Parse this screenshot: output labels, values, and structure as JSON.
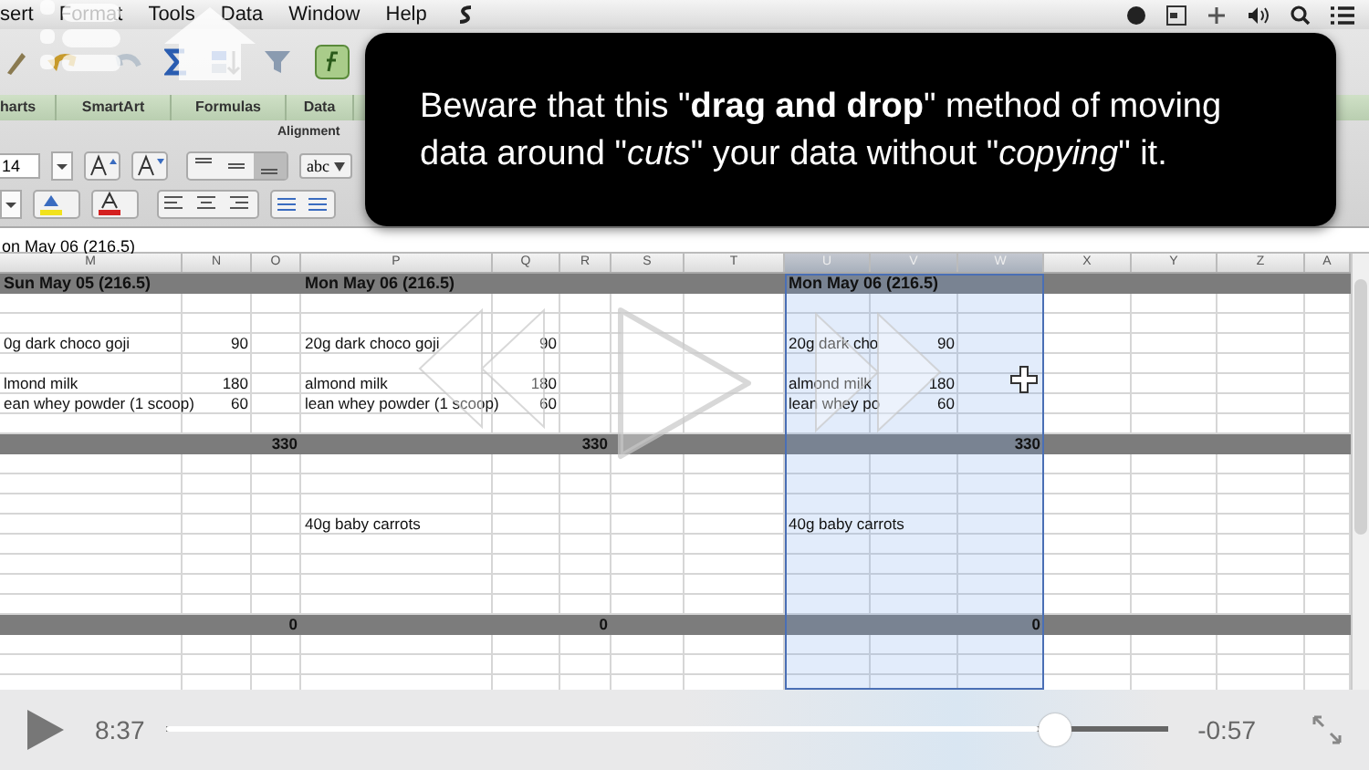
{
  "menu_bar": {
    "items": [
      "sert",
      "Format",
      "Tools",
      "Data",
      "Window",
      "Help"
    ]
  },
  "ribbon": {
    "tabs": [
      {
        "label": "harts",
        "selected": false
      },
      {
        "label": "SmartArt",
        "selected": false
      },
      {
        "label": "Formulas",
        "selected": false
      },
      {
        "label": "Data",
        "selected": false
      }
    ],
    "group_label": "Alignment",
    "font_size": "14",
    "wrap_button": "abc"
  },
  "callout": {
    "text": "Beware that this \"**drag and drop**\" method of moving data around \"*cuts*\" your data without \"*copying*\" it."
  },
  "formula_bar": {
    "value": "on May 06 (216.5)"
  },
  "sheet": {
    "columns": [
      {
        "label": "M",
        "selected": false
      },
      {
        "label": "N",
        "selected": false
      },
      {
        "label": "O",
        "selected": false
      },
      {
        "label": "P",
        "selected": false
      },
      {
        "label": "Q",
        "selected": false
      },
      {
        "label": "R",
        "selected": false
      },
      {
        "label": "S",
        "selected": false
      },
      {
        "label": "T",
        "selected": false
      },
      {
        "label": "U",
        "selected": true
      },
      {
        "label": "V",
        "selected": true
      },
      {
        "label": "W",
        "selected": true
      },
      {
        "label": "X",
        "selected": false
      },
      {
        "label": "Y",
        "selected": false
      },
      {
        "label": "Z",
        "selected": false
      },
      {
        "label": "A",
        "selected": false
      }
    ],
    "rows": [
      {
        "kind": "band",
        "cells": [
          {
            "kind": "title",
            "text": "Sun May 05 (216.5)"
          },
          null,
          null,
          {
            "kind": "title",
            "text": "Mon May 06 (216.5)"
          },
          null,
          null,
          null,
          null,
          {
            "kind": "title",
            "text": "Mon May 06 (216.5)"
          },
          null,
          null,
          null,
          null,
          null,
          null
        ]
      },
      {
        "kind": "blank"
      },
      {
        "kind": "blank"
      },
      {
        "kind": "data",
        "cells": [
          {
            "kind": "label",
            "text": "0g dark choco goji"
          },
          {
            "kind": "number",
            "text": "90"
          },
          null,
          {
            "kind": "label",
            "text": "20g dark choco goji"
          },
          {
            "kind": "number",
            "text": "90"
          },
          null,
          null,
          null,
          {
            "kind": "label",
            "text": "20g dark cho"
          },
          {
            "kind": "number",
            "text": "90"
          },
          null,
          null,
          null,
          null,
          null
        ]
      },
      {
        "kind": "blank"
      },
      {
        "kind": "data",
        "cells": [
          {
            "kind": "label",
            "text": "lmond milk"
          },
          {
            "kind": "number",
            "text": "180"
          },
          null,
          {
            "kind": "label",
            "text": "almond milk"
          },
          {
            "kind": "number",
            "text": "180"
          },
          null,
          null,
          null,
          {
            "kind": "label",
            "text": "almond milk"
          },
          {
            "kind": "number",
            "text": "180"
          },
          null,
          null,
          null,
          null,
          null
        ]
      },
      {
        "kind": "data",
        "cells": [
          {
            "kind": "label",
            "text": "ean whey powder (1 scoop)"
          },
          {
            "kind": "number",
            "text": "60"
          },
          null,
          {
            "kind": "label",
            "text": "lean whey powder (1 scoop)"
          },
          {
            "kind": "number",
            "text": "60"
          },
          null,
          null,
          null,
          {
            "kind": "label",
            "text": "lean whey po"
          },
          {
            "kind": "number",
            "text": "60"
          },
          null,
          null,
          null,
          null,
          null
        ]
      },
      {
        "kind": "blank"
      },
      {
        "kind": "band",
        "cells": [
          null,
          null,
          {
            "kind": "number",
            "text": "330"
          },
          null,
          null,
          {
            "kind": "number",
            "text": "330"
          },
          null,
          null,
          null,
          null,
          {
            "kind": "number",
            "text": "330"
          },
          null,
          null,
          null,
          null
        ]
      },
      {
        "kind": "blank"
      },
      {
        "kind": "blank"
      },
      {
        "kind": "blank"
      },
      {
        "kind": "data",
        "cells": [
          null,
          null,
          null,
          {
            "kind": "label",
            "text": "40g baby carrots"
          },
          null,
          null,
          null,
          null,
          {
            "kind": "label",
            "text": "40g baby carrots"
          },
          null,
          null,
          null,
          null,
          null,
          null
        ]
      },
      {
        "kind": "blank"
      },
      {
        "kind": "blank"
      },
      {
        "kind": "blank"
      },
      {
        "kind": "blank"
      },
      {
        "kind": "band",
        "cells": [
          null,
          null,
          {
            "kind": "number",
            "text": "0"
          },
          null,
          null,
          {
            "kind": "number",
            "text": "0"
          },
          null,
          null,
          null,
          null,
          {
            "kind": "number",
            "text": "0"
          },
          null,
          null,
          null,
          null
        ]
      },
      {
        "kind": "blank"
      },
      {
        "kind": "blank"
      },
      {
        "kind": "blank"
      }
    ]
  },
  "player": {
    "elapsed": "8:37",
    "remaining": "-0:57",
    "level": 0.887
  }
}
